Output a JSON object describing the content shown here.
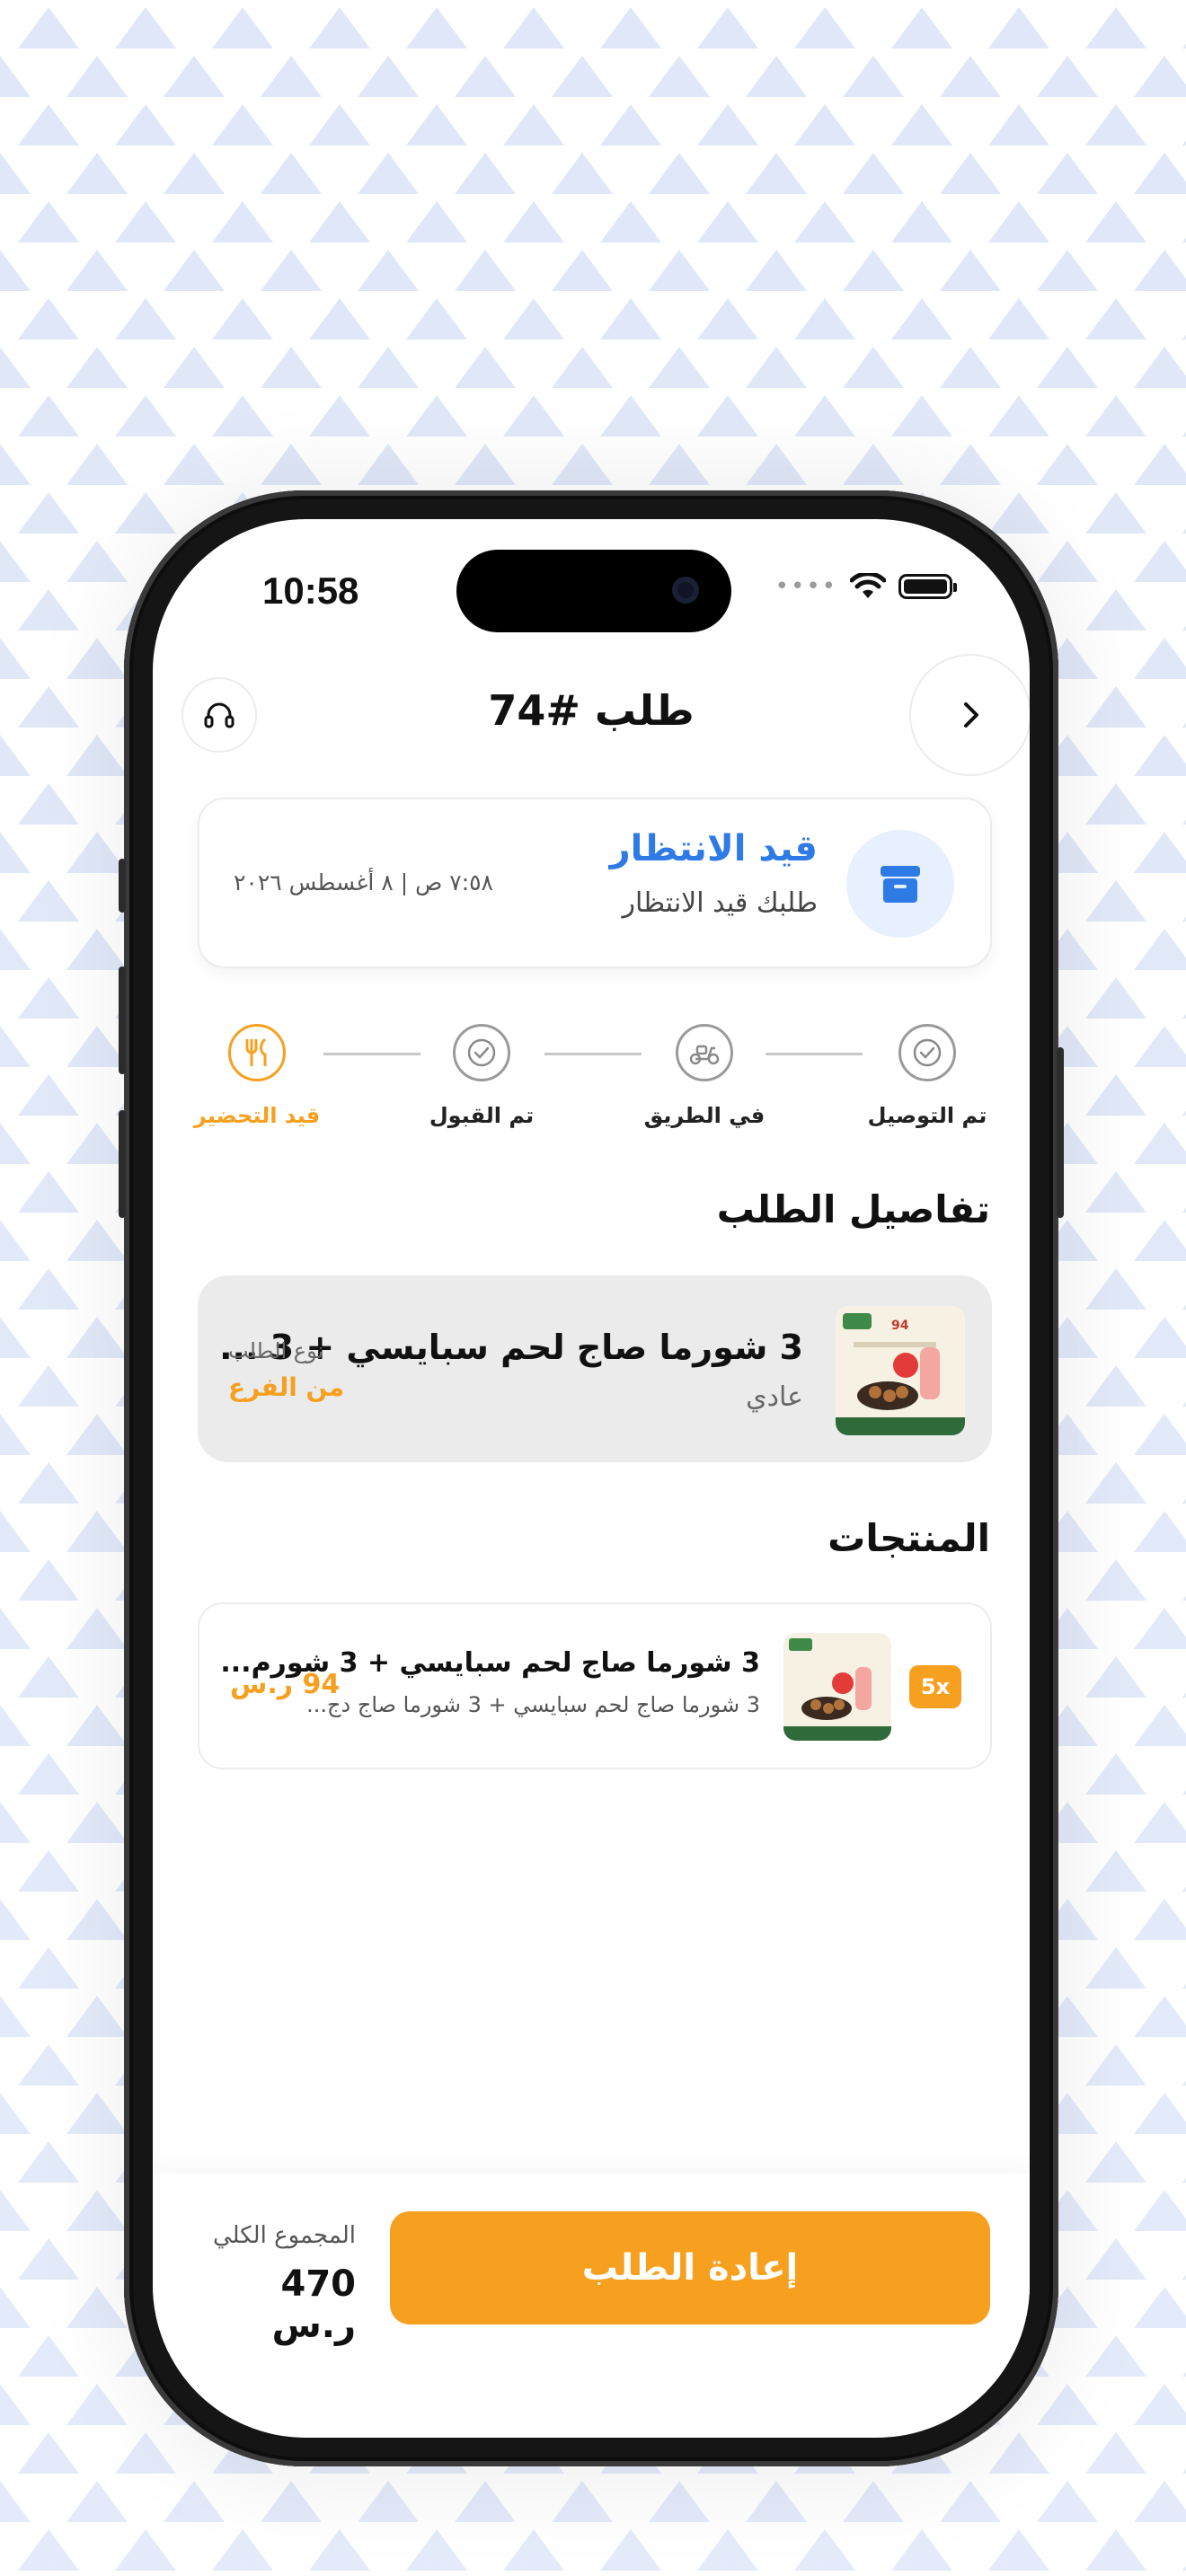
{
  "status_bar": {
    "time": "10:58",
    "signal": "••••"
  },
  "header": {
    "title": "طلب #74",
    "back_icon": "chevron-right-icon",
    "support_icon": "headset-icon"
  },
  "order_status": {
    "title": "قيد الانتظار",
    "subtitle": "طلبك قيد الانتظار",
    "datetime": "٧:٥٨ ص  |  ٨ أغسطس ٢٠٢٦",
    "icon": "archive-box-icon",
    "accent": "#2f7be6"
  },
  "steps": [
    {
      "label": "تم التوصيل",
      "icon": "check-circle-icon",
      "active": false
    },
    {
      "label": "في الطريق",
      "icon": "scooter-icon",
      "active": false
    },
    {
      "label": "تم القبول",
      "icon": "check-circle-icon",
      "active": false
    },
    {
      "label": "قيد التحضير",
      "icon": "utensils-icon",
      "active": true
    }
  ],
  "order_details": {
    "section_title": "تفاصيل الطلب",
    "item_name": "3 شورما صاج لحم سبايسي + 3 ...",
    "item_type": "عادي",
    "order_type_label": "نوع الطلب",
    "order_type_value": "من الفرع",
    "thumb_price_badge": "94"
  },
  "products": {
    "section_title": "المنتجات",
    "items": [
      {
        "qty": "5x",
        "name": "3 شورما صاج لحم سبايسي + 3 شورم...",
        "description": "3 شورما صاج لحم سبايسي + 3 شورما صاج دج...",
        "price": "94 ر.س"
      }
    ]
  },
  "footer": {
    "reorder_label": "إعادة الطلب",
    "total_label": "المجموع الكلي",
    "total_value": "470 ر.س"
  },
  "colors": {
    "accent_orange": "#f7a020",
    "accent_blue": "#2f7be6"
  }
}
